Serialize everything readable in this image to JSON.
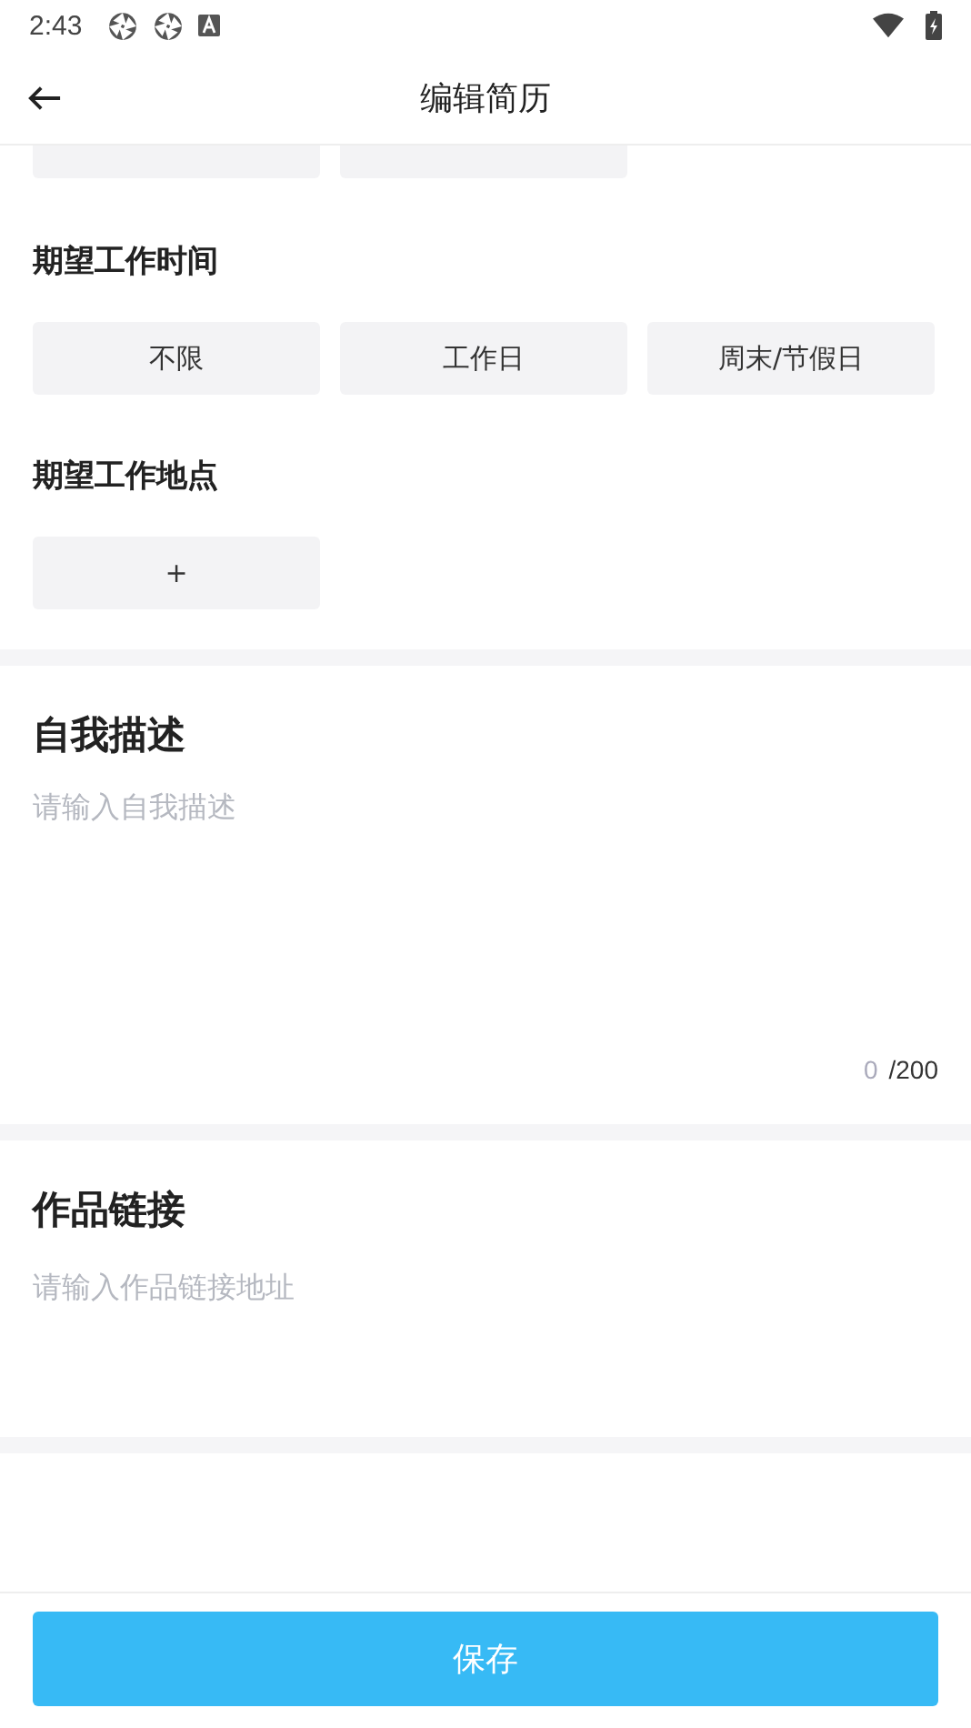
{
  "status_bar": {
    "time": "2:43"
  },
  "header": {
    "title": "编辑简历"
  },
  "sections": [
    {
      "title": "期望工作时间",
      "options": [
        {
          "label": "不限",
          "selected": false
        },
        {
          "label": "工作日",
          "selected": false
        },
        {
          "label": "周末/节假日",
          "selected": false
        }
      ]
    },
    {
      "title": "期望工作地点",
      "options": [
        {
          "label": "+",
          "selected": false
        }
      ]
    }
  ],
  "self_description": {
    "title": "自我描述",
    "placeholder": "请输入自我描述",
    "count": "0",
    "limit": "/200"
  },
  "portfolio": {
    "title": "作品链接",
    "placeholder": "请输入作品链接地址"
  },
  "save_button": "保存"
}
